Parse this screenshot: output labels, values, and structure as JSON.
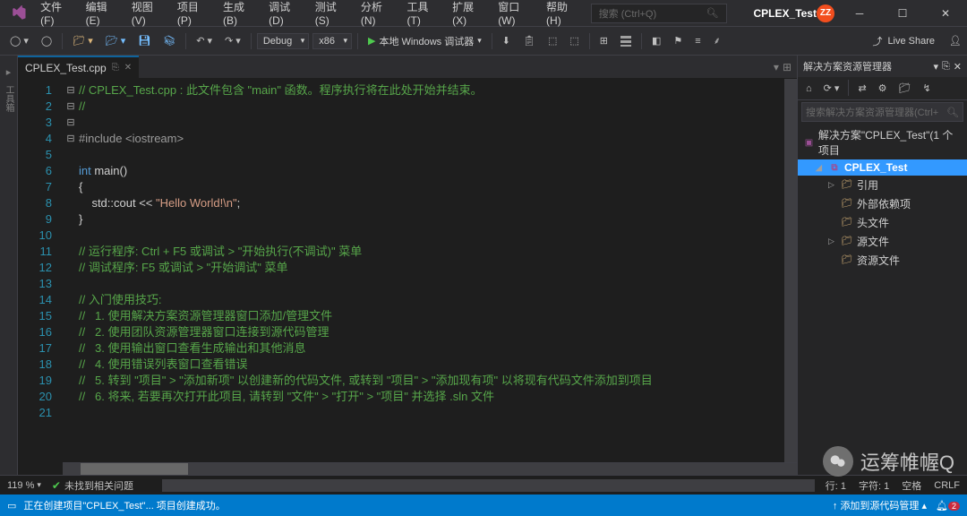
{
  "menu": [
    "文件(F)",
    "编辑(E)",
    "视图(V)",
    "项目(P)",
    "生成(B)",
    "调试(D)",
    "测试(S)",
    "分析(N)",
    "工具(T)",
    "扩展(X)",
    "窗口(W)",
    "帮助(H)"
  ],
  "search_placeholder": "搜索 (Ctrl+Q)",
  "project_name": "CPLEX_Test",
  "avatar_initials": "ZZ",
  "toolbar": {
    "config": "Debug",
    "platform": "x86",
    "start_label": "本地 Windows 调试器"
  },
  "live_share": "Live Share",
  "tab": {
    "name": "CPLEX_Test.cpp"
  },
  "code": {
    "lines": [
      {
        "n": 1,
        "fold": "⊟",
        "html": "<span class='c-comment'>// CPLEX_Test.cpp : 此文件包含 \"main\" 函数。程序执行将在此处开始并结束。</span>"
      },
      {
        "n": 2,
        "fold": "",
        "html": "<span class='c-comment'>//</span>"
      },
      {
        "n": 3,
        "fold": "",
        "html": ""
      },
      {
        "n": 4,
        "fold": "",
        "html": "<span class='c-include'>#include &lt;iostream&gt;</span>"
      },
      {
        "n": 5,
        "fold": "",
        "html": ""
      },
      {
        "n": 6,
        "fold": "⊟",
        "html": "<span class='c-keyword'>int</span> main()"
      },
      {
        "n": 7,
        "fold": "",
        "html": "<span class='c-brace'>{</span>"
      },
      {
        "n": 8,
        "fold": "",
        "html": "    std::cout &lt;&lt; <span class='c-string'>\"Hello World!\\n\"</span>;"
      },
      {
        "n": 9,
        "fold": "",
        "html": "<span class='c-brace'>}</span>"
      },
      {
        "n": 10,
        "fold": "",
        "html": ""
      },
      {
        "n": 11,
        "fold": "⊟",
        "html": "<span class='c-comment'>// 运行程序: Ctrl + F5 或调试 &gt; \"开始执行(不调试)\" 菜单</span>"
      },
      {
        "n": 12,
        "fold": "",
        "html": "<span class='c-comment'>// 调试程序: F5 或调试 &gt; \"开始调试\" 菜单</span>"
      },
      {
        "n": 13,
        "fold": "",
        "html": ""
      },
      {
        "n": 14,
        "fold": "⊟",
        "html": "<span class='c-comment'>// 入门使用技巧:</span>"
      },
      {
        "n": 15,
        "fold": "",
        "html": "<span class='c-comment'>//   1. 使用解决方案资源管理器窗口添加/管理文件</span>"
      },
      {
        "n": 16,
        "fold": "",
        "html": "<span class='c-comment'>//   2. 使用团队资源管理器窗口连接到源代码管理</span>"
      },
      {
        "n": 17,
        "fold": "",
        "html": "<span class='c-comment'>//   3. 使用输出窗口查看生成输出和其他消息</span>"
      },
      {
        "n": 18,
        "fold": "",
        "html": "<span class='c-comment'>//   4. 使用错误列表窗口查看错误</span>"
      },
      {
        "n": 19,
        "fold": "",
        "html": "<span class='c-comment'>//   5. 转到 \"项目\" &gt; \"添加新项\" 以创建新的代码文件, 或转到 \"项目\" &gt; \"添加现有项\" 以将现有代码文件添加到项目</span>"
      },
      {
        "n": 20,
        "fold": "",
        "html": "<span class='c-comment'>//   6. 将来, 若要再次打开此项目, 请转到 \"文件\" &gt; \"打开\" &gt; \"项目\" 并选择 .sln 文件</span>"
      },
      {
        "n": 21,
        "fold": "",
        "html": ""
      }
    ]
  },
  "solution": {
    "title": "解决方案资源管理器",
    "search_placeholder": "搜索解决方案资源管理器(Ctrl+",
    "root": "解决方案\"CPLEX_Test\"(1 个项目",
    "project": "CPLEX_Test",
    "items": [
      "引用",
      "外部依赖项",
      "头文件",
      "源文件",
      "资源文件"
    ]
  },
  "status1": {
    "zoom": "119 %",
    "issues": "未找到相关问题",
    "line": "行: 1",
    "col": "字符: 1",
    "spaces": "空格",
    "eol": "CRLF"
  },
  "blue_bar": {
    "msg": "正在创建项目\"CPLEX_Test\"... 项目创建成功。",
    "add_src": "添加到源代码管理",
    "notif_count": "2"
  },
  "left_toolbox": {
    "label1": "工具箱",
    "label2": "工具箱"
  },
  "watermark": "运筹帷幄Q"
}
